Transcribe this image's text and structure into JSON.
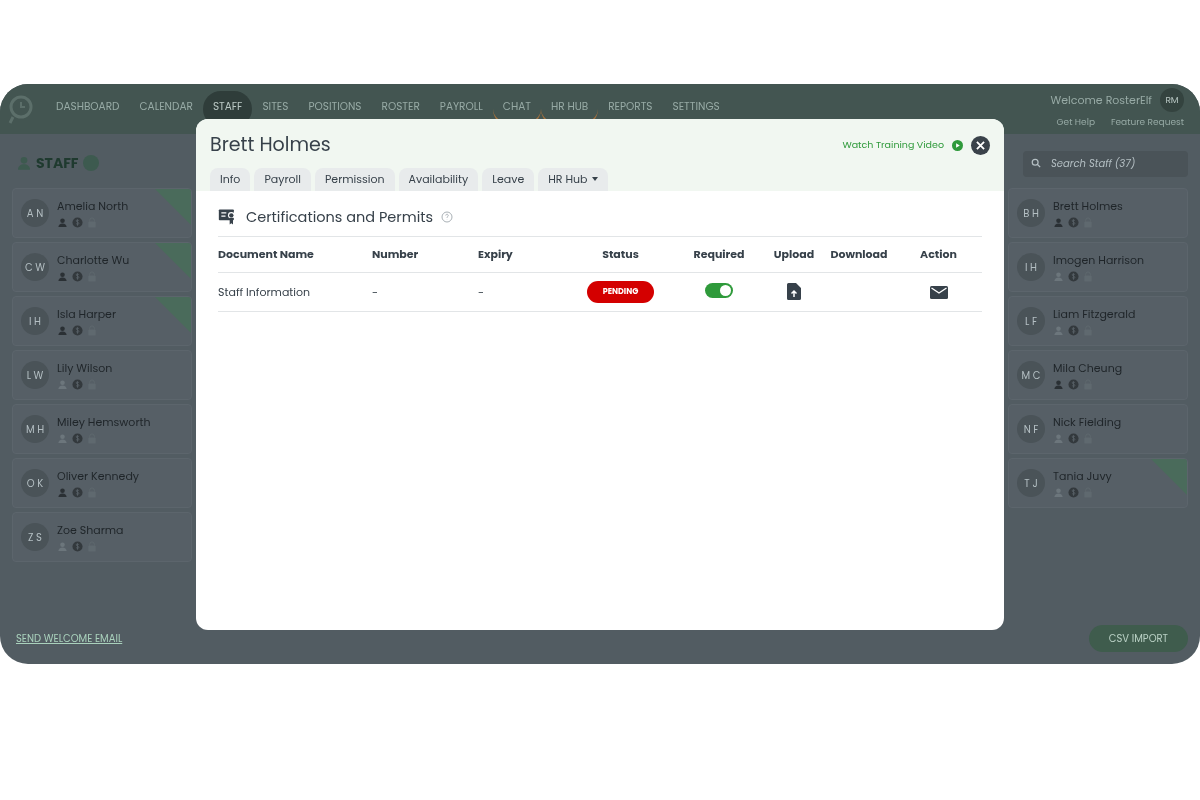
{
  "nav": {
    "items": [
      {
        "label": "DASHBOARD",
        "selected": false,
        "badge": false
      },
      {
        "label": "CALENDAR",
        "selected": false,
        "badge": false
      },
      {
        "label": "STAFF",
        "selected": true,
        "badge": false
      },
      {
        "label": "SITES",
        "selected": false,
        "badge": false
      },
      {
        "label": "POSITIONS",
        "selected": false,
        "badge": false
      },
      {
        "label": "ROSTER",
        "selected": false,
        "badge": false
      },
      {
        "label": "PAYROLL",
        "selected": false,
        "badge": false
      },
      {
        "label": "CHAT",
        "selected": false,
        "badge": true
      },
      {
        "label": "HR HUB",
        "selected": false,
        "badge": true
      },
      {
        "label": "REPORTS",
        "selected": false,
        "badge": false
      },
      {
        "label": "SETTINGS",
        "selected": false,
        "badge": false
      }
    ],
    "welcome": "Welcome RosterElf",
    "avatar": "RM",
    "help": "Get Help",
    "feature": "Feature Request"
  },
  "staff_panel": {
    "title": "STAFF",
    "search": {
      "placeholder": "Search Staff (37)"
    },
    "left_column": [
      {
        "initials": "A N",
        "name": "Amelia North",
        "profile": true,
        "ribbon": true
      },
      {
        "initials": "C W",
        "name": "Charlotte Wu",
        "profile": true,
        "ribbon": true
      },
      {
        "initials": "I H",
        "name": "Isla Harper",
        "profile": true,
        "ribbon": true
      },
      {
        "initials": "L W",
        "name": "Lily Wilson",
        "profile": false,
        "ribbon": false
      },
      {
        "initials": "M H",
        "name": "Miley Hemsworth",
        "profile": false,
        "ribbon": false
      },
      {
        "initials": "O K",
        "name": "Oliver Kennedy",
        "profile": true,
        "ribbon": false
      },
      {
        "initials": "Z S",
        "name": "Zoe Sharma",
        "profile": false,
        "ribbon": false
      }
    ],
    "right_column": [
      {
        "initials": "B H",
        "name": "Brett Holmes",
        "profile": true,
        "ribbon": false
      },
      {
        "initials": "I H",
        "name": "Imogen Harrison",
        "profile": false,
        "ribbon": false
      },
      {
        "initials": "L F",
        "name": "Liam Fitzgerald",
        "profile": false,
        "ribbon": false
      },
      {
        "initials": "M C",
        "name": "Mila Cheung",
        "profile": true,
        "ribbon": false
      },
      {
        "initials": "N F",
        "name": "Nick Fielding",
        "profile": false,
        "ribbon": false
      },
      {
        "initials": "T J",
        "name": "Tania Juvy",
        "profile": false,
        "ribbon": true
      }
    ],
    "send_email": "SEND WELCOME EMAIL",
    "csv_import": "CSV IMPORT"
  },
  "modal": {
    "title": "Brett Holmes",
    "training_link": "Watch Training Video",
    "tabs": [
      {
        "label": "Info",
        "selected": false,
        "dropdown": false
      },
      {
        "label": "Payroll",
        "selected": false,
        "dropdown": false
      },
      {
        "label": "Permission",
        "selected": false,
        "dropdown": false
      },
      {
        "label": "Availability",
        "selected": false,
        "dropdown": false
      },
      {
        "label": "Leave",
        "selected": false,
        "dropdown": false
      },
      {
        "label": "HR Hub",
        "selected": false,
        "dropdown": true
      }
    ],
    "section_title": "Certifications and Permits",
    "table": {
      "columns": [
        "Document Name",
        "Number",
        "Expiry",
        "Status",
        "Required",
        "Upload",
        "Download",
        "Action"
      ],
      "rows": [
        {
          "document_name": "Staff Information",
          "number": "-",
          "expiry": "-",
          "status": "PENDING",
          "required": true
        }
      ]
    }
  }
}
